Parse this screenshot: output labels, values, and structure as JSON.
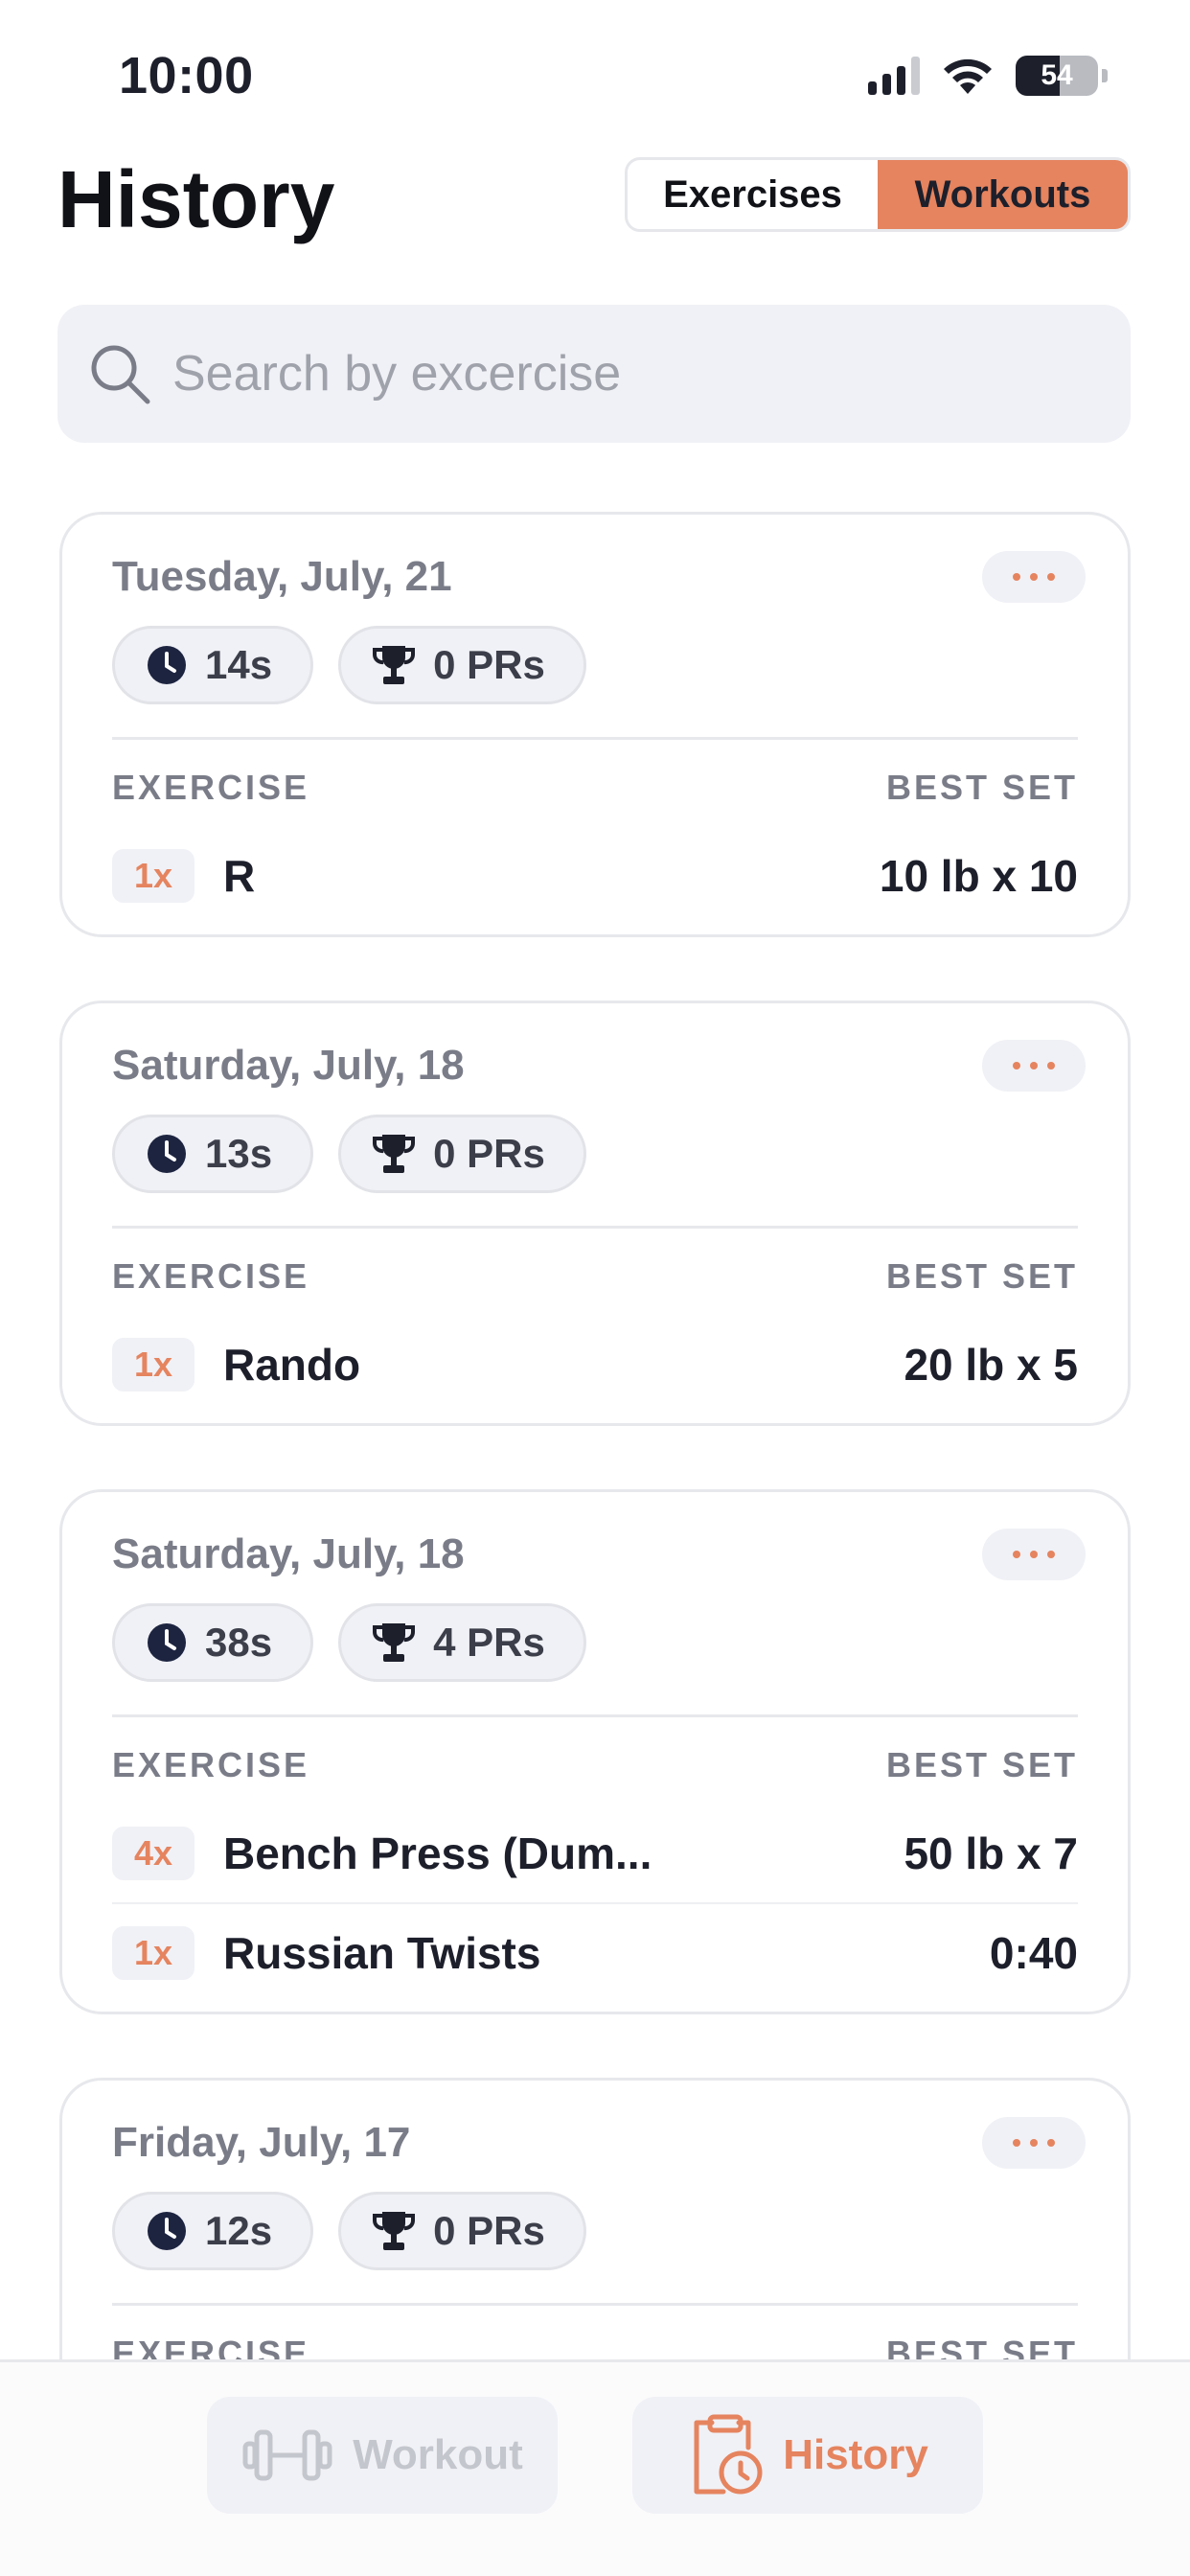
{
  "status_bar": {
    "time": "10:00",
    "battery": "54",
    "battery_level": 0.54
  },
  "header": {
    "title": "History",
    "segments": [
      {
        "label": "Exercises",
        "active": false
      },
      {
        "label": "Workouts",
        "active": true
      }
    ]
  },
  "search": {
    "placeholder": "Search by excercise"
  },
  "columns": {
    "exercise": "EXERCISE",
    "best_set": "BEST SET"
  },
  "workouts": [
    {
      "date": "Tuesday, July, 21",
      "duration": "14s",
      "prs": "0 PRs",
      "exercises": [
        {
          "count": "1x",
          "name": "R",
          "best": "10 lb x 10"
        }
      ]
    },
    {
      "date": "Saturday, July, 18",
      "duration": "13s",
      "prs": "0 PRs",
      "exercises": [
        {
          "count": "1x",
          "name": "Rando",
          "best": "20 lb x 5"
        }
      ]
    },
    {
      "date": "Saturday, July, 18",
      "duration": "38s",
      "prs": "4 PRs",
      "exercises": [
        {
          "count": "4x",
          "name": "Bench Press (Dum...",
          "best": "50 lb x 7"
        },
        {
          "count": "1x",
          "name": "Russian Twists",
          "best": "0:40"
        }
      ]
    },
    {
      "date": "Friday, July, 17",
      "duration": "12s",
      "prs": "0 PRs",
      "exercises": []
    }
  ],
  "tab_bar": {
    "tabs": [
      {
        "label": "Workout",
        "active": false,
        "icon": "dumbbell-icon"
      },
      {
        "label": "History",
        "active": true,
        "icon": "clipboard-clock-icon"
      }
    ]
  },
  "colors": {
    "accent": "#e5845f",
    "muted": "#7a7d88",
    "surface": "#f0f1f6"
  }
}
